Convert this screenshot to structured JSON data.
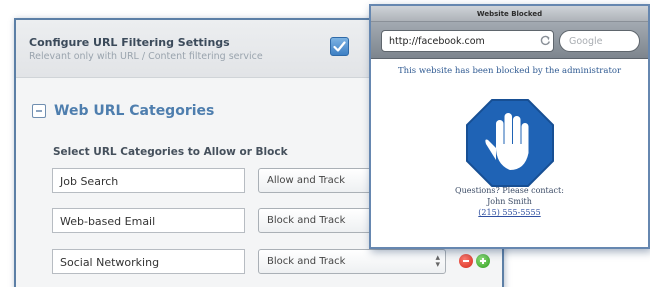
{
  "settings": {
    "title": "Configure URL Filtering Settings",
    "subtitle": "Relevant only with URL / Content filtering service",
    "checkbox_checked": true,
    "section_title": "Web URL Categories",
    "prompt": "Select URL Categories to Allow or Block",
    "rows": [
      {
        "category": "Job Search",
        "action": "Allow and Track"
      },
      {
        "category": "Web-based Email",
        "action": "Block and Track"
      },
      {
        "category": "Social Networking",
        "action": "Block and Track"
      }
    ],
    "colors": {
      "accent": "#4e7eae",
      "remove": "#d22a1c",
      "add": "#2e9a1e"
    }
  },
  "browser": {
    "title": "Website Blocked",
    "url": "http://facebook.com",
    "search_placeholder": "Google",
    "message": "This website has been blocked by the administrator",
    "contact_prompt": "Questions? Please contact:",
    "contact_name": "John Smith",
    "contact_phone": "(215) 555-5555",
    "stop_sign_color": "#1f63b5",
    "icons": [
      "reload-icon",
      "stop-hand-icon"
    ]
  }
}
